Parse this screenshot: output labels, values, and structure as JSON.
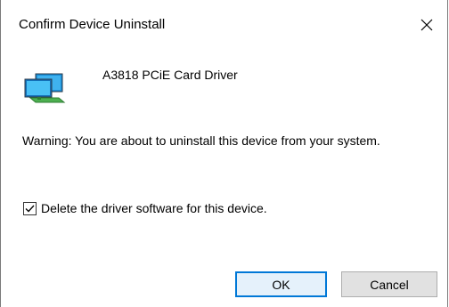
{
  "window": {
    "title": "Confirm Device Uninstall",
    "close_icon": "close-icon"
  },
  "device": {
    "icon": "network-adapter-icon",
    "name": "A3818 PCiE Card Driver"
  },
  "warning_text": "Warning: You are about to uninstall this device from your system.",
  "delete_driver": {
    "checked": true,
    "label": "Delete the driver software for this device."
  },
  "buttons": {
    "ok_label": "OK",
    "cancel_label": "Cancel"
  },
  "colors": {
    "ok_border": "#0078d7",
    "ok_background": "#e5f1fb",
    "button_background": "#e1e1e1"
  }
}
